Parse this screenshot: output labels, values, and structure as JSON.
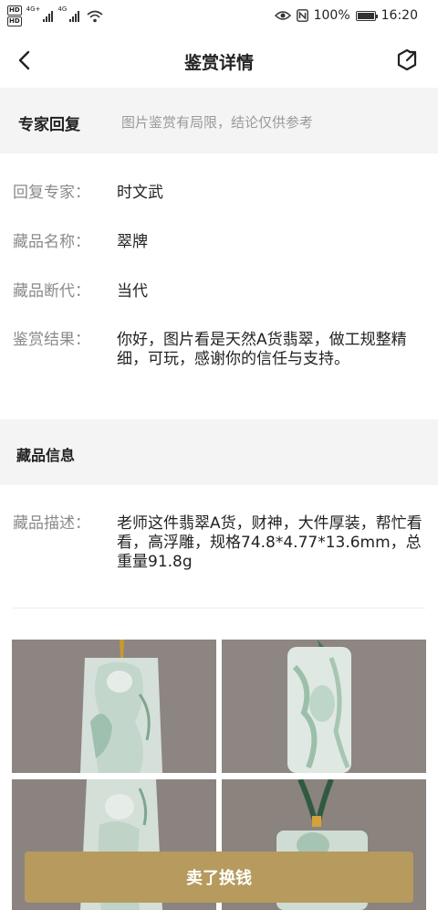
{
  "status_bar": {
    "hd1": "HD",
    "hd2": "HD",
    "net1": "4G+",
    "net2": "4G",
    "battery_pct": "100%",
    "battery_level": 1.0,
    "time": "16:20",
    "icons": [
      "hd-icon",
      "signal-icon",
      "wifi-icon",
      "eye-icon",
      "nfc-icon",
      "battery-icon"
    ]
  },
  "nav": {
    "title": "鉴赏详情",
    "back_icon": "chevron-left-icon",
    "share_icon": "share-icon"
  },
  "expert_section": {
    "title": "专家回复",
    "note": "图片鉴赏有局限，结论仅供参考"
  },
  "details": [
    {
      "label": "回复专家：",
      "value": "时文武"
    },
    {
      "label": "藏品名称：",
      "value": "翠牌"
    },
    {
      "label": "藏品断代：",
      "value": "当代"
    },
    {
      "label": "鉴赏结果：",
      "value": "你好，图片看是天然A货翡翠，做工规整精细，可玩，感谢你的信任与支持。"
    }
  ],
  "info_section": {
    "title": "藏品信息",
    "desc_label": "藏品描述：",
    "desc_value": "老师这件翡翠A货，财神，大件厚装，帮忙看看，高浮雕，规格74.8*4.77*13.6mm，总重量91.8g"
  },
  "photos": [
    "jade-pendant-front",
    "jade-pendant-back",
    "jade-pendant-angle",
    "jade-pendant-cord"
  ],
  "bottom": {
    "sell_label": "卖了换钱"
  },
  "colors": {
    "accent": "#b69a5e",
    "band_bg": "#f4f4f4",
    "label_gray": "#8a8a8a",
    "photo_bg": "#8d8581",
    "jade_light": "#d9e4dd",
    "jade_green": "#6f9e82"
  }
}
